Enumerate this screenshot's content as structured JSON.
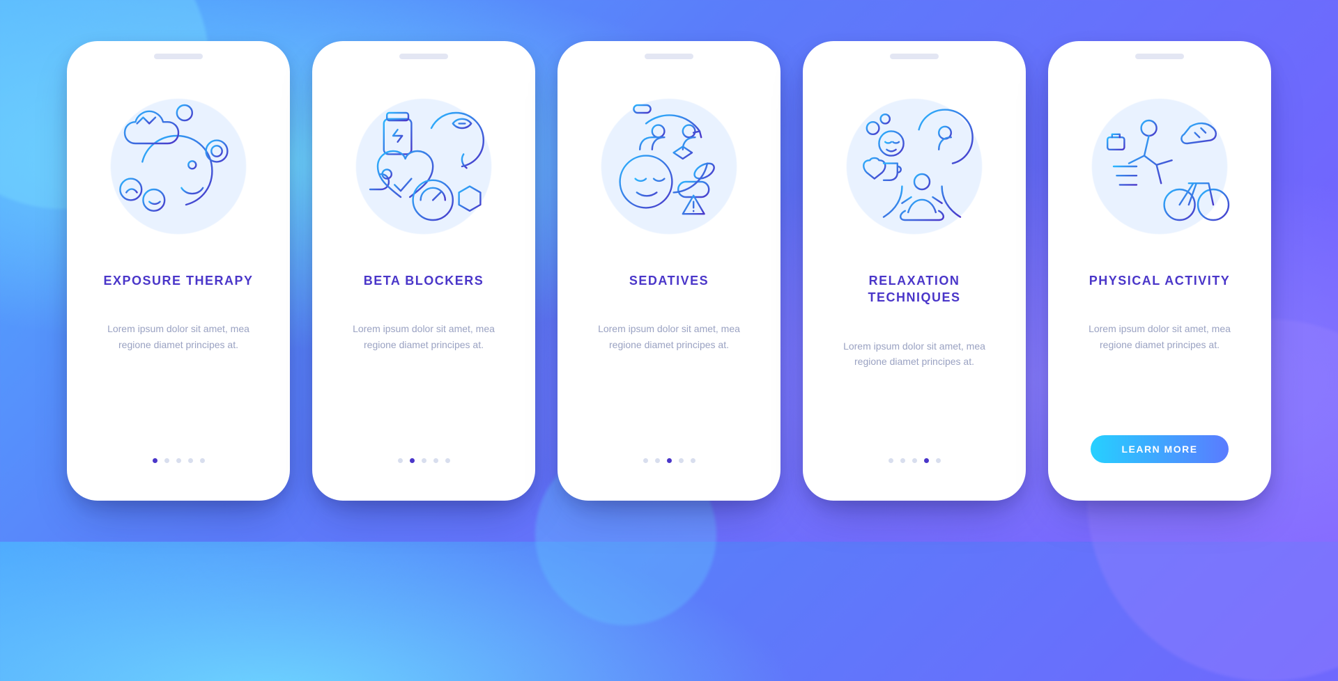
{
  "colors": {
    "gradient_from": "#2ab7ff",
    "gradient_to": "#4a36c9",
    "title": "#4a36c9",
    "desc": "#9aa2c2",
    "cta_from": "#26d0ff",
    "cta_to": "#5a7bff"
  },
  "lorem": "Lorem ipsum dolor sit amet, mea regione diamet principes at.",
  "screens": [
    {
      "icon": "exposure-therapy-icon",
      "title": "EXPOSURE THERAPY",
      "active_index": 0,
      "has_cta": false
    },
    {
      "icon": "beta-blockers-icon",
      "title": "BETA BLOCKERS",
      "active_index": 1,
      "has_cta": false
    },
    {
      "icon": "sedatives-icon",
      "title": "SEDATIVES",
      "active_index": 2,
      "has_cta": false
    },
    {
      "icon": "relaxation-techniques-icon",
      "title": "RELAXATION TECHNIQUES",
      "active_index": 3,
      "has_cta": false
    },
    {
      "icon": "physical-activity-icon",
      "title": "PHYSICAL ACTIVITY",
      "active_index": 4,
      "has_cta": true,
      "cta_label": "LEARN MORE"
    }
  ],
  "dots_count": 5
}
